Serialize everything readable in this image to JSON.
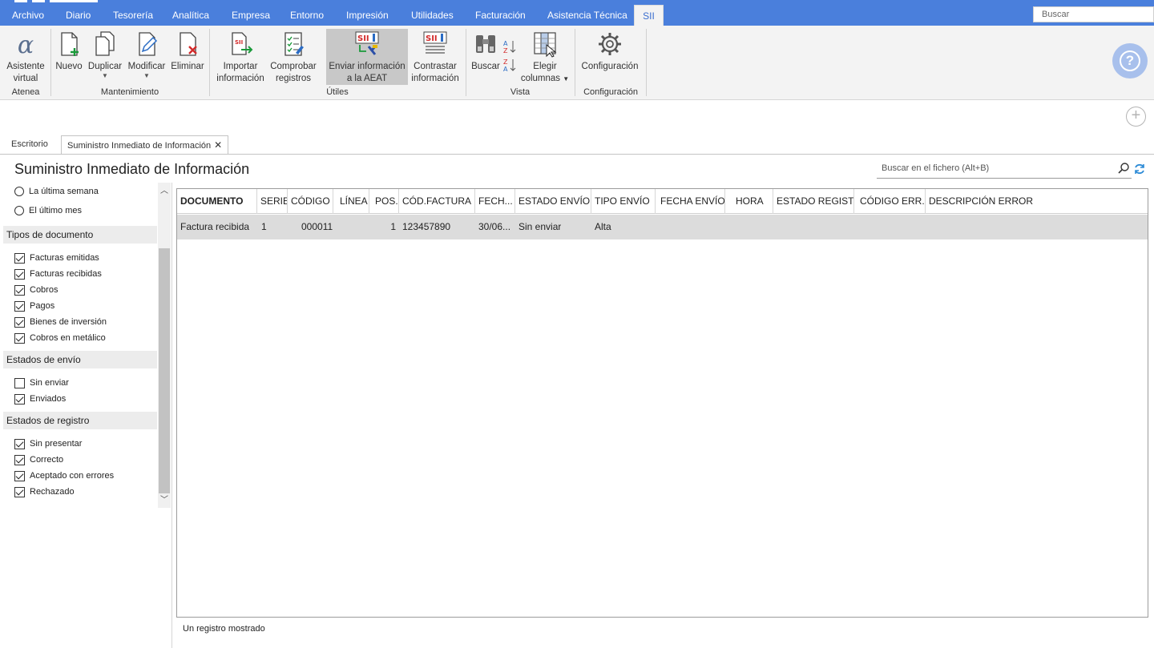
{
  "menu": {
    "items": [
      "Archivo",
      "Diario",
      "Tesorería",
      "Analítica",
      "Empresa",
      "Entorno",
      "Impresión",
      "Utilidades",
      "Facturación",
      "Asistencia Técnica",
      "SII"
    ],
    "search_placeholder": "Buscar"
  },
  "ribbon": {
    "buttons": {
      "asistente": "Asistente virtual",
      "nuevo": "Nuevo",
      "duplicar": "Duplicar",
      "modificar": "Modificar",
      "eliminar": "Eliminar",
      "importar": "Importar información",
      "comprobar": "Comprobar registros",
      "enviar": "Enviar información a la AEAT",
      "contrastar": "Contrastar información",
      "buscar": "Buscar",
      "elegir": "Elegir columnas",
      "configuracion": "Configuración"
    },
    "groups": {
      "atenea": "Atenea",
      "mantenimiento": "Mantenimiento",
      "utiles": "Útiles",
      "vista": "Vista",
      "configuracion": "Configuración"
    }
  },
  "tabs": [
    "Escritorio",
    "Suministro Inmediato de Información"
  ],
  "page": {
    "title": "Suministro Inmediato de Información",
    "search_placeholder": "Buscar en el fichero (Alt+B)"
  },
  "filters": {
    "periods": [
      {
        "label": "La última semana",
        "selected": false
      },
      {
        "label": "El último mes",
        "selected": false
      }
    ],
    "doc_types_header": "Tipos de documento",
    "doc_types": [
      {
        "label": "Facturas emitidas",
        "checked": true
      },
      {
        "label": "Facturas recibidas",
        "checked": true
      },
      {
        "label": "Cobros",
        "checked": true
      },
      {
        "label": "Pagos",
        "checked": true
      },
      {
        "label": "Bienes de inversión",
        "checked": true
      },
      {
        "label": "Cobros en metálico",
        "checked": true
      }
    ],
    "send_states_header": "Estados de envío",
    "send_states": [
      {
        "label": "Sin enviar",
        "checked": false
      },
      {
        "label": "Enviados",
        "checked": true
      }
    ],
    "reg_states_header": "Estados de registro",
    "reg_states": [
      {
        "label": "Sin presentar",
        "checked": true
      },
      {
        "label": "Correcto",
        "checked": true
      },
      {
        "label": "Aceptado con errores",
        "checked": true
      },
      {
        "label": "Rechazado",
        "checked": true
      }
    ]
  },
  "grid": {
    "columns": [
      "DOCUMENTO",
      "SERIE",
      "CÓDIGO",
      "LÍNEA",
      "POS.",
      "CÓD.FACTURA",
      "FECH...",
      "ESTADO ENVÍO",
      "TIPO ENVÍO",
      "FECHA ENVÍO",
      "HORA",
      "ESTADO REGIST...",
      "CÓDIGO ERR...",
      "DESCRIPCIÓN ERROR"
    ],
    "rows": [
      [
        "Factura recibida",
        "1",
        "000011",
        "",
        "1",
        "123457890",
        "30/06...",
        "Sin enviar",
        "Alta",
        "",
        "",
        "",
        "",
        ""
      ]
    ]
  },
  "status": "Un registro mostrado",
  "colors": {
    "menu_bg": "#4a7fdc",
    "ribbon_bg": "#f3f3f3",
    "selected_row": "#dcdcdc",
    "accent": "#3a6ecf"
  }
}
